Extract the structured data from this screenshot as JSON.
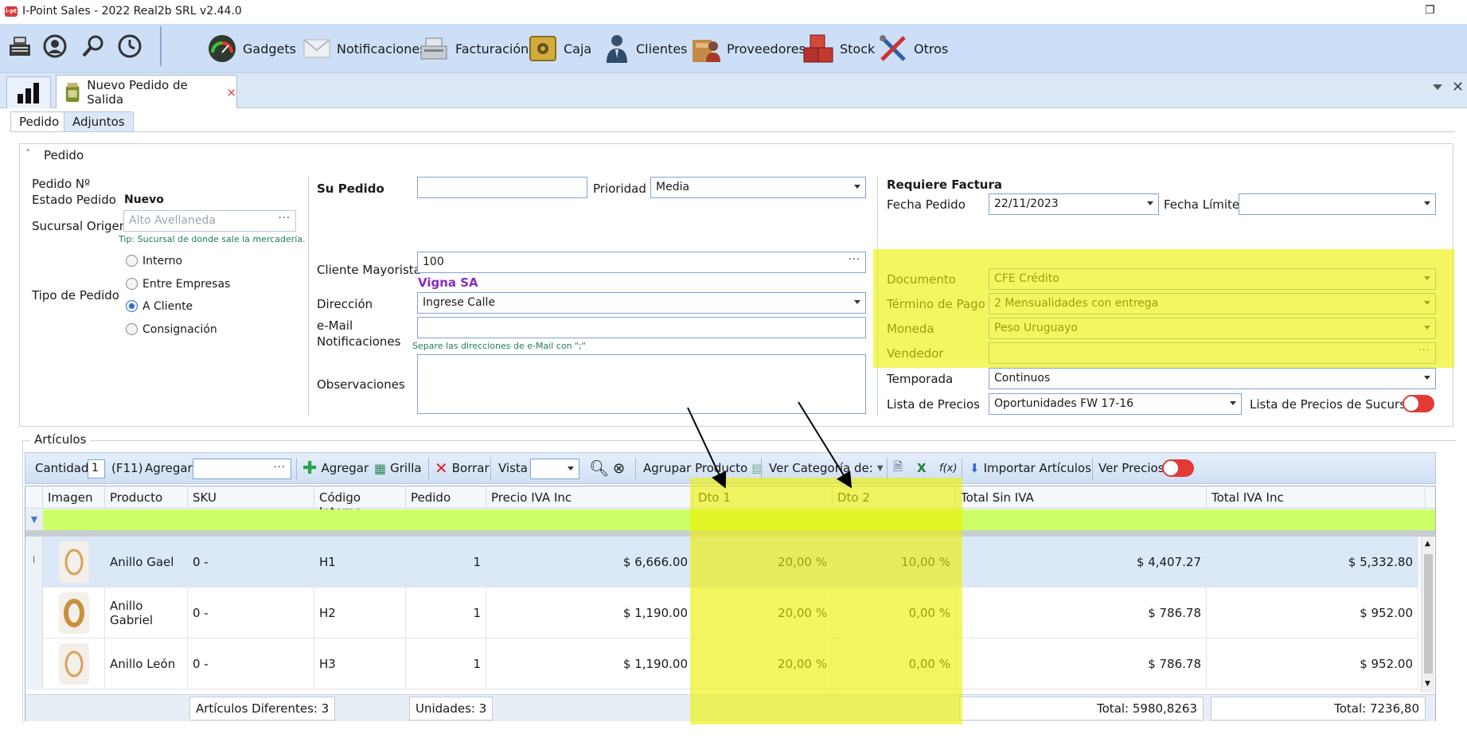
{
  "app": {
    "title": "I-Point Sales  - 2022 Real2b SRL v2.44.0",
    "badge": "i-pt"
  },
  "menu": [
    {
      "label": "Gadgets",
      "icon": "gauge-icon",
      "color": "#2f3b2f"
    },
    {
      "label": "Notificaciones",
      "icon": "envelope-icon",
      "color": "#d9dde3"
    },
    {
      "label": "Facturación",
      "icon": "cash-register-icon",
      "color": "#8f9aa5"
    },
    {
      "label": "Caja",
      "icon": "safe-icon",
      "color": "#c8a23a"
    },
    {
      "label": "Clientes",
      "icon": "person-icon",
      "color": "#2f4a6b"
    },
    {
      "label": "Proveedores",
      "icon": "supplier-icon",
      "color": "#b47a3c"
    },
    {
      "label": "Stock",
      "icon": "boxes-icon",
      "color": "#b5312b"
    },
    {
      "label": "Otros",
      "icon": "tools-icon",
      "color": "#2d5fa8"
    }
  ],
  "quick_icons": [
    "pos-terminal-icon",
    "user-circle-icon",
    "search-icon",
    "clock-icon"
  ],
  "doc_tab": {
    "label": "Nuevo Pedido de Salida",
    "close": "×"
  },
  "sub_tabs": [
    "Pedido",
    "Adjuntos"
  ],
  "section": {
    "title": "Pedido",
    "toggle": "˄"
  },
  "left": {
    "pedido_no_label": "Pedido Nº",
    "estado_label": "Estado Pedido",
    "estado_value": "Nuevo",
    "sucursal_label": "Sucursal Origen",
    "sucursal_placeholder": "Alto Avellaneda",
    "sucursal_tip": "Tip: Sucursal de donde sale la mercadería.",
    "tipo_label": "Tipo de Pedido",
    "tipos": [
      "Interno",
      "Entre Empresas",
      "A Cliente",
      "Consignación"
    ],
    "tipo_selected": "A Cliente"
  },
  "middle": {
    "su_pedido_label": "Su Pedido",
    "su_pedido_value": "",
    "prioridad_label": "Prioridad",
    "prioridad_value": "Media",
    "cliente_label": "Cliente Mayorista",
    "cliente_value": "100",
    "cliente_name": "Vigna SA",
    "direccion_label": "Dirección",
    "direccion_value": "Ingrese Calle",
    "email_label_1": "e-Mail",
    "email_label_2": "Notificaciones",
    "email_value": "",
    "email_tip": "Separe las direcciones de e-Mail con \";\"",
    "obs_label": "Observaciones",
    "obs_value": ""
  },
  "right": {
    "requiere_factura": "Requiere Factura",
    "fecha_pedido_label": "Fecha Pedido",
    "fecha_pedido_value": "22/11/2023",
    "fecha_limite_label": "Fecha Límite",
    "fecha_limite_value": "",
    "documento_label": "Documento",
    "documento_value": "CFE Crédito",
    "termino_label": "Término de Pago",
    "termino_value": "2 Mensualidades con entrega",
    "moneda_label": "Moneda",
    "moneda_value": "Peso Uruguayo",
    "vendedor_label": "Vendedor",
    "vendedor_value": "",
    "temporada_label": "Temporada",
    "temporada_value": "Continuos",
    "lista_label": "Lista de Precios",
    "lista_value": "Oportunidades FW 17-16",
    "lista_sucursal_label": "Lista de Precios de Sucursal"
  },
  "articulos": {
    "group_title": "Artículos",
    "toolbar": {
      "cantidad_label": "Cantidad",
      "cantidad_value": "1",
      "f11": "(F11)",
      "agregar_label": "Agregar",
      "agregar_btn": "Agregar",
      "grilla_btn": "Grilla",
      "borrar_btn": "Borrar",
      "vista_label": "Vista",
      "agrupar": "Agrupar Producto",
      "ver_categoria": "Ver Categoría de:",
      "importar": "Importar Artículos",
      "ver_precios": "Ver Precios"
    },
    "columns": [
      "Imagen",
      "Producto",
      "SKU",
      "Código Interno",
      "Pedido",
      "Precio IVA Inc",
      "Dto 1",
      "Dto 2",
      "Total Sin IVA",
      "Total IVA Inc"
    ],
    "rows": [
      {
        "producto": "Anillo Gael",
        "sku": "0 -",
        "codigo": "H1",
        "pedido": "1",
        "precio": "$ 6,666.00",
        "dto1": "20,00 %",
        "dto2": "10,00 %",
        "total_sin": "$ 4,407.27",
        "total_iva": "$ 5,332.80"
      },
      {
        "producto": "Anillo Gabriel",
        "sku": "0 -",
        "codigo": "H2",
        "pedido": "1",
        "precio": "$ 1,190.00",
        "dto1": "20,00 %",
        "dto2": "0,00 %",
        "total_sin": "$ 786.78",
        "total_iva": "$ 952.00"
      },
      {
        "producto": "Anillo León",
        "sku": "0 -",
        "codigo": "H3",
        "pedido": "1",
        "precio": "$ 1,190.00",
        "dto1": "20,00 %",
        "dto2": "0,00 %",
        "total_sin": "$ 786.78",
        "total_iva": "$ 952.00"
      }
    ],
    "footer": {
      "articulos_diferentes": "Artículos Diferentes: 3",
      "unidades": "Unidades: 3",
      "total_sin": "Total: 5980,8263",
      "total_iva": "Total: 7236,80"
    }
  },
  "colors": {
    "highlight": "#eef000",
    "filter_row": "#ccff66",
    "toolbar_bg": "#ccdff6",
    "toggle_off": "#e53935"
  }
}
